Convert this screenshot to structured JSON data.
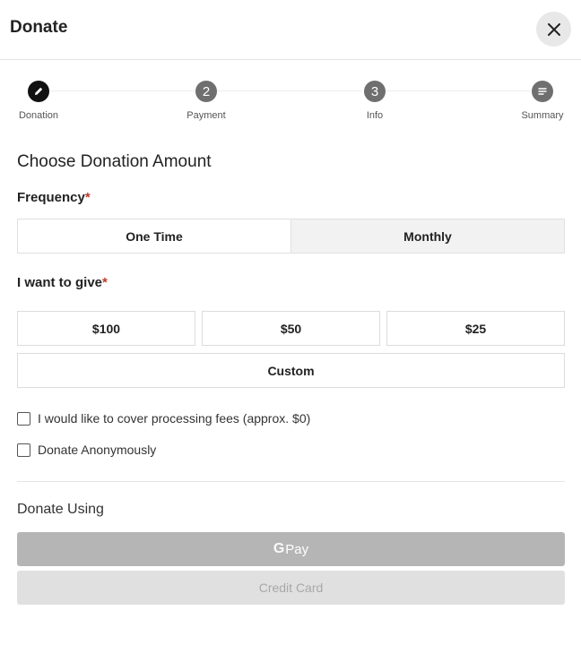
{
  "header": {
    "title": "Donate",
    "close_icon": "close-icon"
  },
  "stepper": {
    "steps": [
      {
        "label": "Donation",
        "marker": "pencil-icon",
        "state": "active"
      },
      {
        "label": "Payment",
        "marker": "2",
        "state": "inactive"
      },
      {
        "label": "Info",
        "marker": "3",
        "state": "inactive"
      },
      {
        "label": "Summary",
        "marker": "list-icon",
        "state": "inactive"
      }
    ]
  },
  "form": {
    "section_title": "Choose Donation Amount",
    "frequency": {
      "label": "Frequency",
      "required_mark": "*",
      "options": [
        "One Time",
        "Monthly"
      ],
      "selected": "Monthly"
    },
    "amount": {
      "label": "I want to give",
      "required_mark": "*",
      "options": [
        "$100",
        "$50",
        "$25"
      ],
      "custom_label": "Custom"
    },
    "checkboxes": [
      {
        "label": "I would like to cover processing fees (approx. $0)",
        "checked": false
      },
      {
        "label": "Donate Anonymously",
        "checked": false
      }
    ]
  },
  "payment": {
    "heading": "Donate Using",
    "gpay_g": "G",
    "gpay_label": "Pay",
    "card_label": "Credit Card"
  },
  "colors": {
    "required": "#c0392b",
    "active_step": "#111111",
    "inactive_step": "#6f6f6f",
    "gpay_bg": "#b5b5b5",
    "card_bg": "#e0e0e0"
  }
}
